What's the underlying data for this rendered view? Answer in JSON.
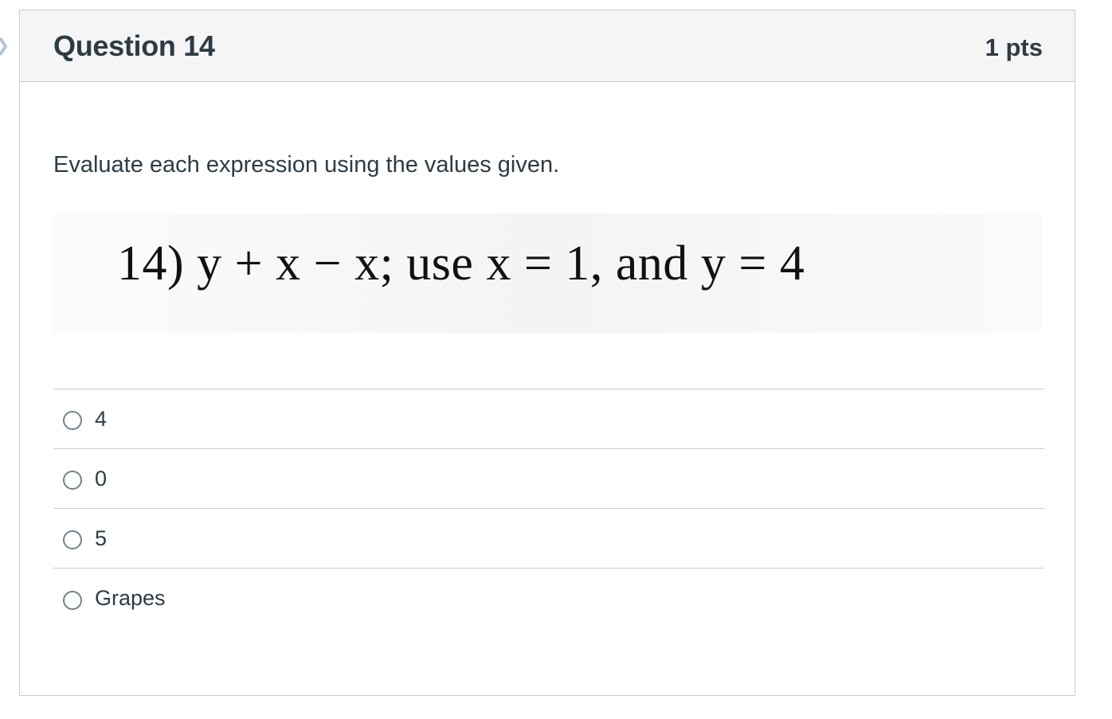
{
  "question": {
    "title": "Question 14",
    "points": "1 pts",
    "prompt": "Evaluate each expression using the values given.",
    "problem_image_text": "14)  y + x − x; use x = 1, and y = 4",
    "answers": [
      {
        "label": "4"
      },
      {
        "label": "0"
      },
      {
        "label": "5"
      },
      {
        "label": "Grapes"
      }
    ]
  },
  "icons": {
    "nav": "chevron-right-icon",
    "radio": "radio-unselected-icon"
  },
  "colors": {
    "text": "#2d3b45",
    "header_bg": "#f5f5f5",
    "border": "#c7cdd1",
    "radio": "#73818b"
  }
}
